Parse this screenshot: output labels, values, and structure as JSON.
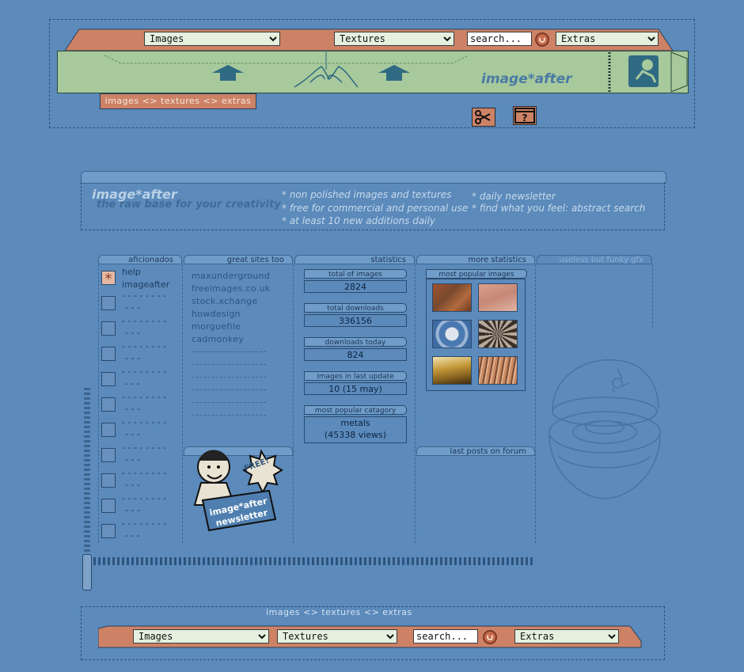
{
  "top_nav": {
    "images_select": "Images",
    "textures_select": "Textures",
    "search_placeholder": "search...",
    "extras_select": "Extras"
  },
  "banner": {
    "logo": "image*after",
    "tagline_tab": "images <> textures <> extras"
  },
  "intro": {
    "logo": "image*after",
    "tagline": "the raw base for your creativity",
    "bullets_left": [
      "* non polished images and textures",
      "* free for commercial and personal use",
      "* at least 10 new additions daily"
    ],
    "bullets_right": [
      "* daily newsletter",
      "* find what you feel: abstract search"
    ]
  },
  "columns": {
    "aficionados": "aficionados",
    "great_sites": "great sites too",
    "statistics": "statistics",
    "more_statistics": "more statistics",
    "useless": "useless but funky gfx",
    "last_posts": "last posts on forum"
  },
  "aficionados": {
    "first_line_1": "help",
    "first_line_2": "imageafter",
    "placeholder_line_1": "- - - - - - - -",
    "placeholder_line_2": "- - -"
  },
  "great_sites": [
    "maxunderground",
    "freeimages.co.uk",
    "stock.xchange",
    "howdesign",
    "morguefile",
    "cadmonkey"
  ],
  "statistics": [
    {
      "label": "total of images",
      "value": "2824"
    },
    {
      "label": "total downloads",
      "value": "336156"
    },
    {
      "label": "downloads today",
      "value": "824"
    },
    {
      "label": "images in last update",
      "value": "10 (15 may)"
    },
    {
      "label": "most popular catagory",
      "value": "metals",
      "value2": "(45338 views)"
    }
  ],
  "more_statistics": {
    "most_popular_images": "most popular images"
  },
  "newsletter": {
    "free_badge": "FREE!",
    "line1": "image*after",
    "line2": "newsletter"
  },
  "bottom_nav": {
    "tagline": "images <> textures <> extras",
    "images_select": "Images",
    "textures_select": "Textures",
    "search_placeholder": "search...",
    "extras_select": "Extras"
  },
  "colors": {
    "background": "#5b8abb",
    "nav_salmon": "#cd8266",
    "banner_green": "#a7c99b"
  }
}
